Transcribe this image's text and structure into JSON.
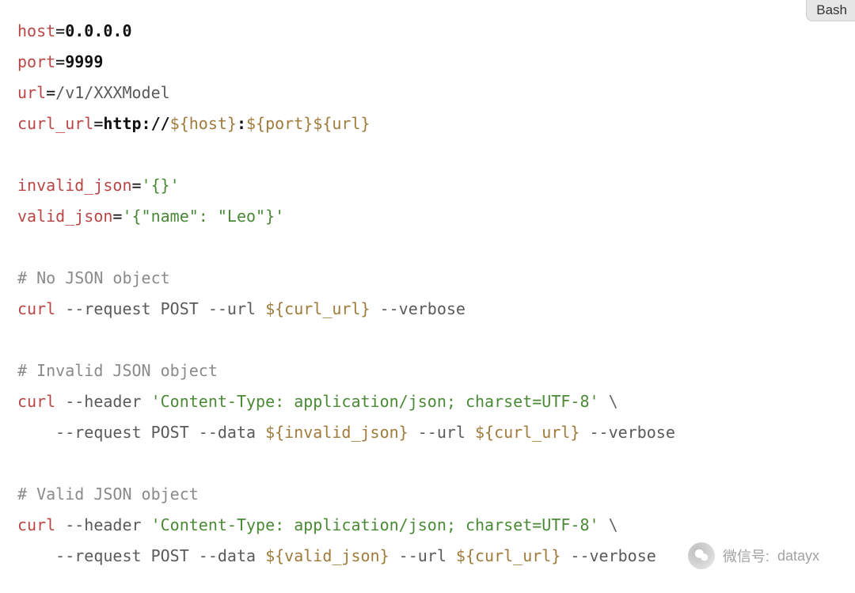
{
  "badge": "Bash",
  "code": {
    "l1": {
      "var": "host",
      "val": "0.0.0.0"
    },
    "l2": {
      "var": "port",
      "val": "9999"
    },
    "l3": {
      "var": "url",
      "val": "/v1/XXXModel"
    },
    "l4": {
      "var": "curl_url",
      "proto": "http://",
      "i1": "${host}",
      "colon": ":",
      "i2": "${port}",
      "i3": "${url}"
    },
    "l5": {
      "var": "invalid_json",
      "str": "'{}'"
    },
    "l6": {
      "var": "valid_json",
      "str": "'{\"name\": \"Leo\"}'"
    },
    "c1": "# No JSON object",
    "l7": {
      "cmd": "curl",
      "a": " --request POST --url ",
      "i1": "${curl_url}",
      "b": " --verbose"
    },
    "c2": "# Invalid JSON object",
    "l8": {
      "cmd": "curl",
      "a": " --header ",
      "str": "'Content-Type: application/json; charset=UTF-8'",
      "cont": " \\"
    },
    "l9": {
      "indent": "    ",
      "a": "--request POST --data ",
      "i1": "${invalid_json}",
      "b": " --url ",
      "i2": "${curl_url}",
      "c": " --verbose"
    },
    "c3": "# Valid JSON object",
    "l10": {
      "cmd": "curl",
      "a": " --header ",
      "str": "'Content-Type: application/json; charset=UTF-8'",
      "cont": " \\"
    },
    "l11": {
      "indent": "    ",
      "a": "--request POST --data ",
      "i1": "${valid_json}",
      "b": " --url ",
      "i2": "${curl_url}",
      "c": " --verbose"
    }
  },
  "watermark": {
    "label": "微信号:",
    "id": "datayx"
  }
}
